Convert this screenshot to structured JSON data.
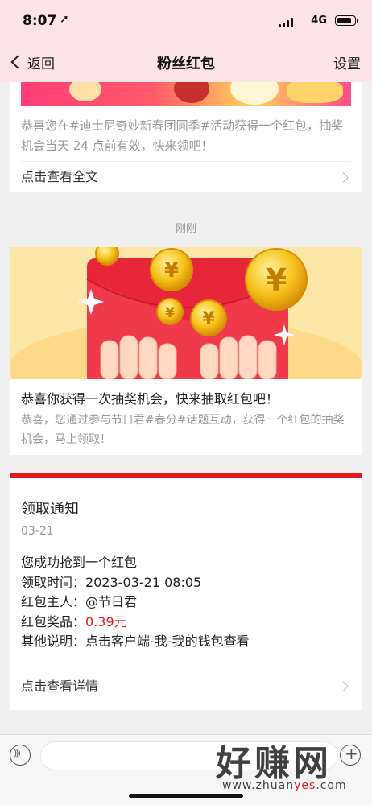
{
  "status_bar": {
    "time": "8:07",
    "network": "4G",
    "battery_level": 0.85
  },
  "nav": {
    "back_label": "返回",
    "title": "粉丝红包",
    "settings_label": "设置"
  },
  "card1": {
    "description": "恭喜您在#迪士尼奇妙新春团圆季#活动获得一个红包，抽奖机会当天 24 点前有效，快来领吧！",
    "more_label": "点击查看全文"
  },
  "time_label": "刚刚",
  "card2": {
    "headline": "恭喜你获得一次抽奖机会，快来抽取红包吧！",
    "subtext": "恭喜，您通过参与节日君#春分#话题互动，获得一个红包的抽奖机会，马上领取！",
    "coin_symbol": "¥"
  },
  "card3": {
    "title": "领取通知",
    "date": "03-21",
    "line1": "您成功抢到一个红包",
    "time_key": "领取时间：",
    "time_value": "2023-03-21 08:05",
    "owner_key": "红包主人：",
    "owner_value": "@节日君",
    "prize_key": "红包奖品：",
    "prize_value": "0.39元",
    "note_key": "其他说明：",
    "note_value": "点击客户端-我-我的钱包查看",
    "more_label": "点击查看详情"
  },
  "watermark": {
    "text": "好赚网",
    "url_prefix": "www.zhuan",
    "url_highlight": "yes",
    "url_suffix": ".com"
  },
  "colors": {
    "accent_red": "#e4161e",
    "header_bg": "#fbe3e6"
  }
}
